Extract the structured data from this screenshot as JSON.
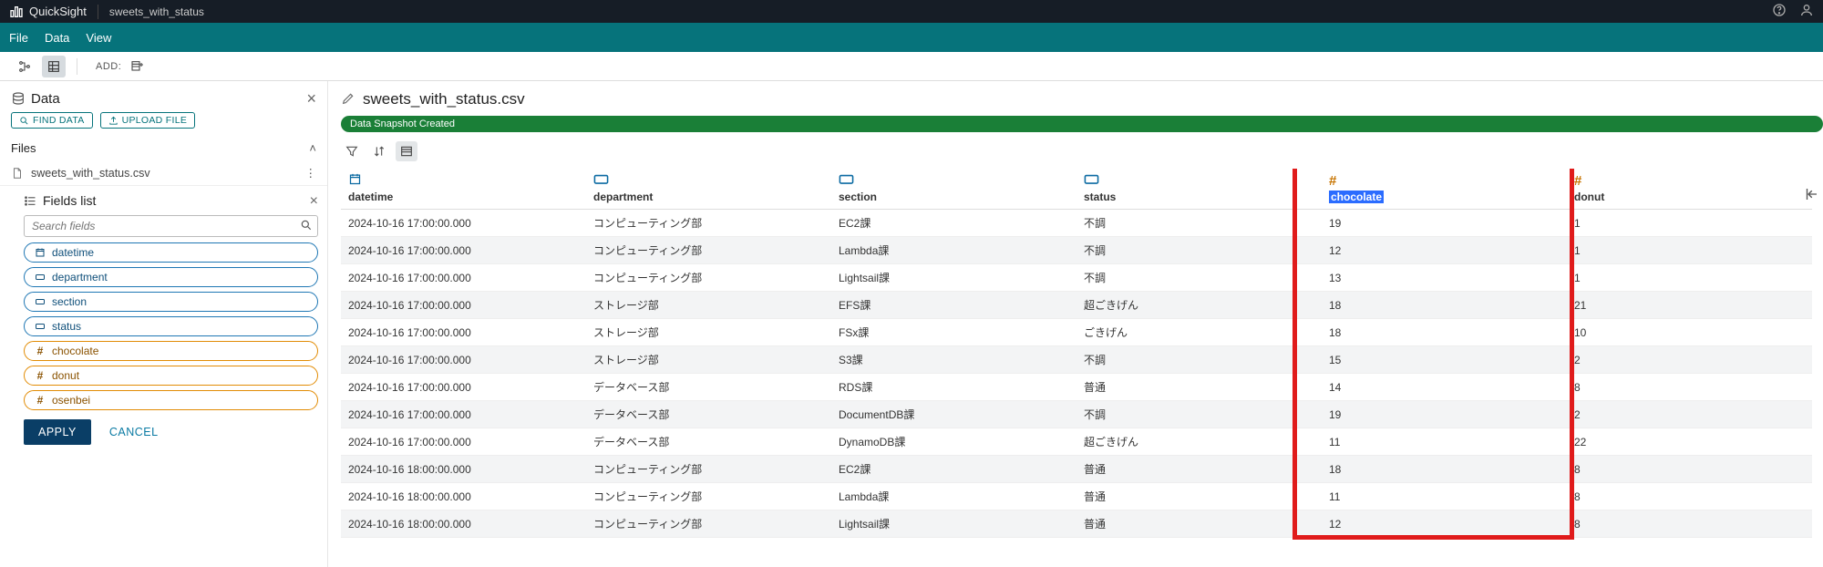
{
  "topbar": {
    "brand": "QuickSight",
    "doc": "sweets_with_status"
  },
  "menus": {
    "file": "File",
    "data": "Data",
    "view": "View"
  },
  "toolbar": {
    "add_label": "ADD:"
  },
  "data_pane": {
    "title": "Data",
    "find_data": "FIND DATA",
    "upload_file": "UPLOAD FILE",
    "files_label": "Files",
    "file_name": "sweets_with_status.csv"
  },
  "fields_panel": {
    "title": "Fields list",
    "search_placeholder": "Search fields",
    "apply": "APPLY",
    "cancel": "CANCEL",
    "fields": [
      {
        "name": "datetime",
        "kind": "date"
      },
      {
        "name": "department",
        "kind": "text"
      },
      {
        "name": "section",
        "kind": "text"
      },
      {
        "name": "status",
        "kind": "text"
      },
      {
        "name": "chocolate",
        "kind": "num"
      },
      {
        "name": "donut",
        "kind": "num"
      },
      {
        "name": "osenbei",
        "kind": "num"
      }
    ]
  },
  "doc": {
    "name": "sweets_with_status.csv",
    "snapshot_badge": "Data Snapshot Created"
  },
  "table": {
    "columns": [
      {
        "key": "datetime",
        "label": "datetime",
        "type": "date"
      },
      {
        "key": "department",
        "label": "department",
        "type": "text"
      },
      {
        "key": "section",
        "label": "section",
        "type": "text"
      },
      {
        "key": "status",
        "label": "status",
        "type": "text"
      },
      {
        "key": "chocolate",
        "label": "chocolate",
        "type": "num",
        "highlighted": true
      },
      {
        "key": "donut",
        "label": "donut",
        "type": "num"
      }
    ],
    "rows": [
      {
        "datetime": "2024-10-16 17:00:00.000",
        "department": "コンピューティング部",
        "section": "EC2課",
        "status": "不調",
        "chocolate": "19",
        "donut": "1"
      },
      {
        "datetime": "2024-10-16 17:00:00.000",
        "department": "コンピューティング部",
        "section": "Lambda課",
        "status": "不調",
        "chocolate": "12",
        "donut": "1"
      },
      {
        "datetime": "2024-10-16 17:00:00.000",
        "department": "コンピューティング部",
        "section": "Lightsail課",
        "status": "不調",
        "chocolate": "13",
        "donut": "1"
      },
      {
        "datetime": "2024-10-16 17:00:00.000",
        "department": "ストレージ部",
        "section": "EFS課",
        "status": "超ごきげん",
        "chocolate": "18",
        "donut": "21"
      },
      {
        "datetime": "2024-10-16 17:00:00.000",
        "department": "ストレージ部",
        "section": "FSx課",
        "status": "ごきげん",
        "chocolate": "18",
        "donut": "10"
      },
      {
        "datetime": "2024-10-16 17:00:00.000",
        "department": "ストレージ部",
        "section": "S3課",
        "status": "不調",
        "chocolate": "15",
        "donut": "2"
      },
      {
        "datetime": "2024-10-16 17:00:00.000",
        "department": "データベース部",
        "section": "RDS課",
        "status": "普通",
        "chocolate": "14",
        "donut": "8"
      },
      {
        "datetime": "2024-10-16 17:00:00.000",
        "department": "データベース部",
        "section": "DocumentDB課",
        "status": "不調",
        "chocolate": "19",
        "donut": "2"
      },
      {
        "datetime": "2024-10-16 17:00:00.000",
        "department": "データベース部",
        "section": "DynamoDB課",
        "status": "超ごきげん",
        "chocolate": "11",
        "donut": "22"
      },
      {
        "datetime": "2024-10-16 18:00:00.000",
        "department": "コンピューティング部",
        "section": "EC2課",
        "status": "普通",
        "chocolate": "18",
        "donut": "8"
      },
      {
        "datetime": "2024-10-16 18:00:00.000",
        "department": "コンピューティング部",
        "section": "Lambda課",
        "status": "普通",
        "chocolate": "11",
        "donut": "8"
      },
      {
        "datetime": "2024-10-16 18:00:00.000",
        "department": "コンピューティング部",
        "section": "Lightsail課",
        "status": "普通",
        "chocolate": "12",
        "donut": "8"
      }
    ]
  }
}
